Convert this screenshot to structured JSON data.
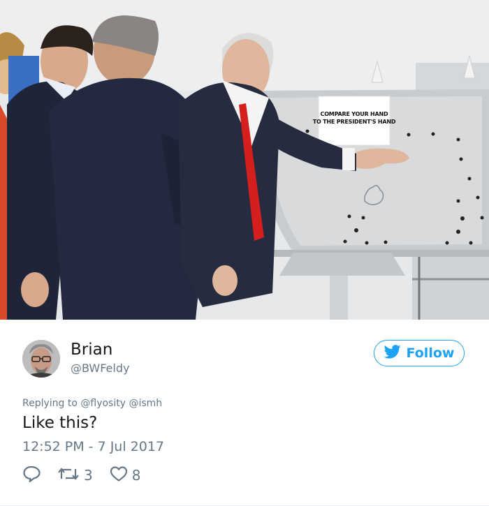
{
  "photo": {
    "sign_line1": "COMPARE YOUR HAND",
    "sign_line2": "TO THE PRESIDENT'S HAND"
  },
  "tweet": {
    "display_name": "Brian",
    "handle": "@BWFeldy",
    "follow_label": "Follow",
    "replying_to": "Replying to @flyosity @ismh",
    "text": "Like this?",
    "timestamp": "12:52 PM - 7 Jul 2017",
    "retweet_count": "3",
    "like_count": "8"
  },
  "icons": {
    "follow": "twitter-bird-icon",
    "reply": "reply-icon",
    "retweet": "retweet-icon",
    "like": "heart-icon"
  },
  "colors": {
    "accent": "#1da1f2",
    "secondary_text": "#657786",
    "primary_text": "#14171a"
  }
}
